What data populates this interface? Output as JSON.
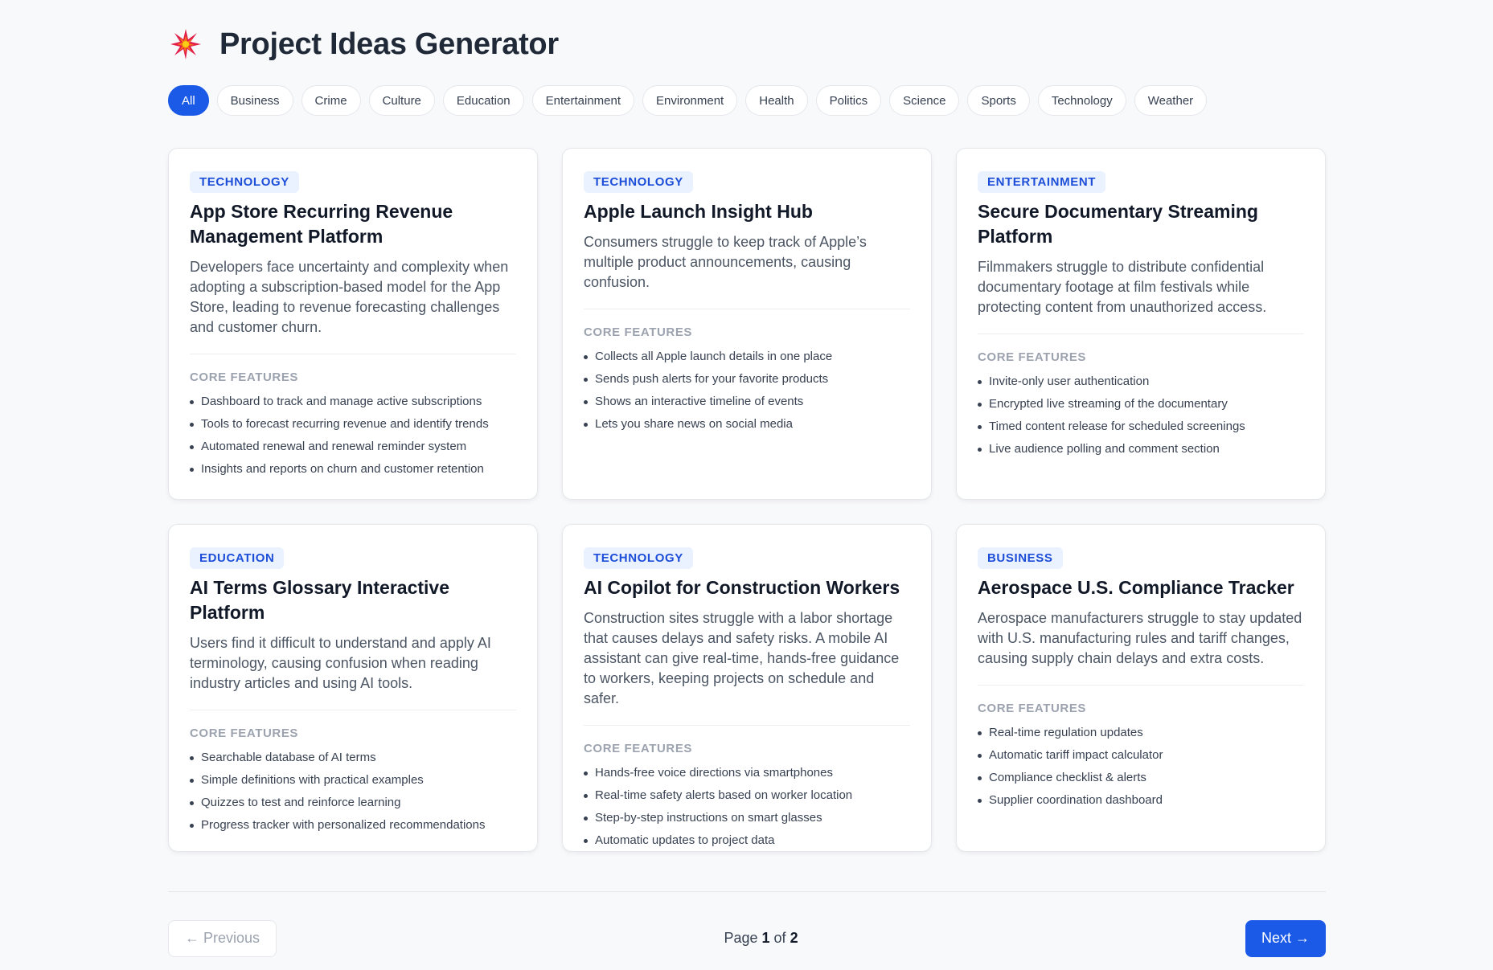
{
  "header": {
    "title": "Project Ideas Generator",
    "logo_icon": "sparkle-icon"
  },
  "filters": {
    "active": "All",
    "items": [
      "All",
      "Business",
      "Crime",
      "Culture",
      "Education",
      "Entertainment",
      "Environment",
      "Health",
      "Politics",
      "Science",
      "Sports",
      "Technology",
      "Weather"
    ]
  },
  "features_heading": "CORE FEATURES",
  "cards": [
    {
      "category": "TECHNOLOGY",
      "title": "App Store Recurring Revenue Management Platform",
      "description": "Developers face uncertainty and complexity when adopting a subscription-based model for the App Store, leading to revenue forecasting challenges and customer churn.",
      "features": [
        "Dashboard to track and manage active subscriptions",
        "Tools to forecast recurring revenue and identify trends",
        "Automated renewal and renewal reminder system",
        "Insights and reports on churn and customer retention"
      ]
    },
    {
      "category": "TECHNOLOGY",
      "title": "Apple Launch Insight Hub",
      "description": "Consumers struggle to keep track of Apple’s multiple product announcements, causing confusion.",
      "features": [
        "Collects all Apple launch details in one place",
        "Sends push alerts for your favorite products",
        "Shows an interactive timeline of events",
        "Lets you share news on social media"
      ]
    },
    {
      "category": "ENTERTAINMENT",
      "title": "Secure Documentary Streaming Platform",
      "description": "Filmmakers struggle to distribute confidential documentary footage at film festivals while protecting content from unauthorized access.",
      "features": [
        "Invite-only user authentication",
        "Encrypted live streaming of the documentary",
        "Timed content release for scheduled screenings",
        "Live audience polling and comment section"
      ]
    },
    {
      "category": "EDUCATION",
      "title": "AI Terms Glossary Interactive Platform",
      "description": "Users find it difficult to understand and apply AI terminology, causing confusion when reading industry articles and using AI tools.",
      "features": [
        "Searchable database of AI terms",
        "Simple definitions with practical examples",
        "Quizzes to test and reinforce learning",
        "Progress tracker with personalized recommendations"
      ]
    },
    {
      "category": "TECHNOLOGY",
      "title": "AI Copilot for Construction Workers",
      "description": "Construction sites struggle with a labor shortage that causes delays and safety risks. A mobile AI assistant can give real-time, hands-free guidance to workers, keeping projects on schedule and safer.",
      "features": [
        "Hands-free voice directions via smartphones",
        "Real-time safety alerts based on worker location",
        "Step-by-step instructions on smart glasses",
        "Automatic updates to project data"
      ]
    },
    {
      "category": "BUSINESS",
      "title": "Aerospace U.S. Compliance Tracker",
      "description": "Aerospace manufacturers struggle to stay updated with U.S. manufacturing rules and tariff changes, causing supply chain delays and extra costs.",
      "features": [
        "Real-time regulation updates",
        "Automatic tariff impact calculator",
        "Compliance checklist & alerts",
        "Supplier coordination dashboard"
      ]
    }
  ],
  "pagination": {
    "prev_label": "← Previous",
    "page_prefix": "Page",
    "current": "1",
    "of_label": "of",
    "total": "2",
    "next_label": "Next →"
  },
  "colors": {
    "accent": "#1a5ae6",
    "badge_bg": "#eaf1ff",
    "badge_text": "#1d4ed8"
  }
}
